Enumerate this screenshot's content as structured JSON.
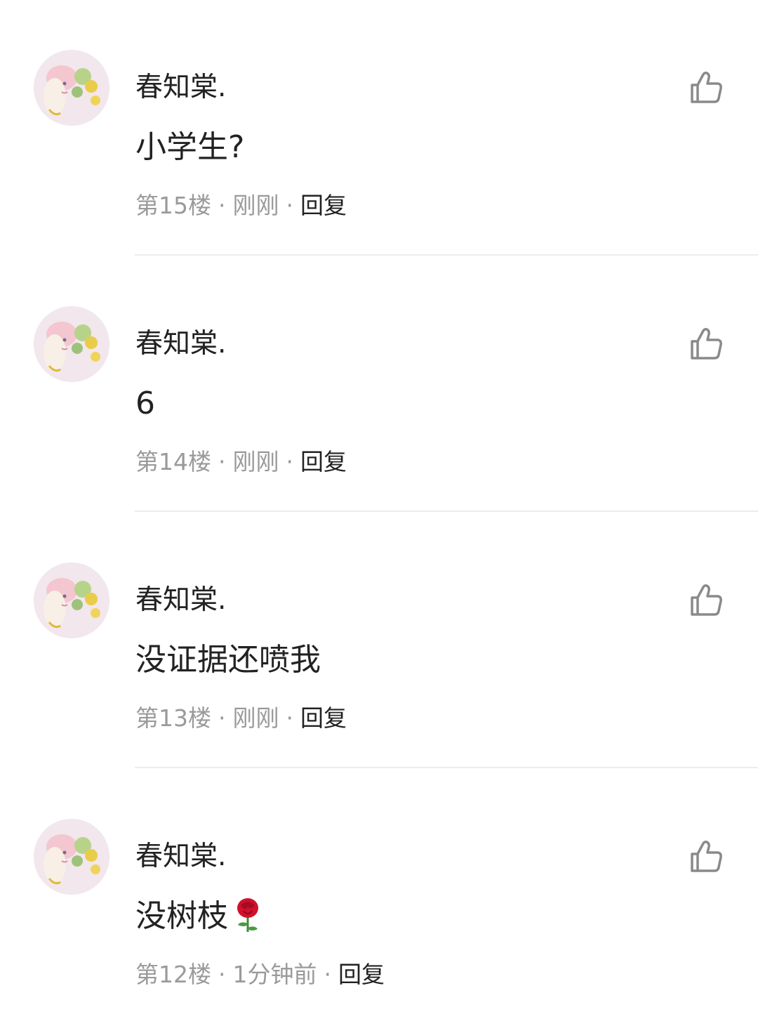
{
  "comments": [
    {
      "username": "春知棠.",
      "content": "小学生?",
      "floor": "第15楼",
      "time": "刚刚",
      "reply_label": "回复",
      "has_rose": false
    },
    {
      "username": "春知棠.",
      "content": "6",
      "floor": "第14楼",
      "time": "刚刚",
      "reply_label": "回复",
      "has_rose": false
    },
    {
      "username": "春知棠.",
      "content": "没证据还喷我",
      "floor": "第13楼",
      "time": "刚刚",
      "reply_label": "回复",
      "has_rose": false
    },
    {
      "username": "春知棠.",
      "content": "没树枝",
      "floor": "第12楼",
      "time": "1分钟前",
      "reply_label": "回复",
      "has_rose": true
    }
  ],
  "separator": "·",
  "icons": {
    "like": "thumbs-up-icon",
    "emoji": "rose-icon"
  },
  "colors": {
    "text_primary": "#222222",
    "text_secondary": "#9a9a9a",
    "divider": "#ececec",
    "icon_gray": "#8a8a8a",
    "rose_red": "#d0112b"
  }
}
